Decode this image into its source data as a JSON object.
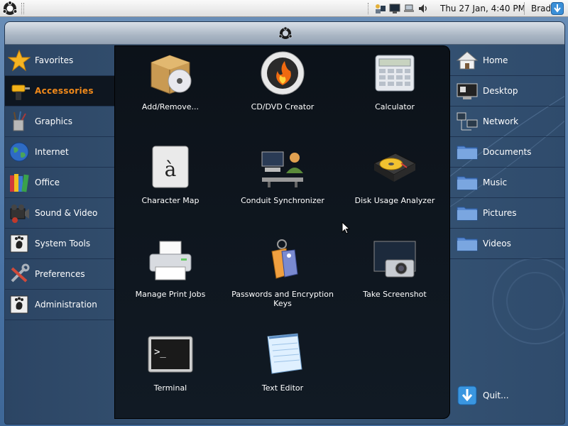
{
  "top_panel": {
    "clock": "Thu 27 Jan,  4:40 PM",
    "user": "Brad"
  },
  "categories": [
    {
      "label": "Favorites",
      "icon": "star-icon"
    },
    {
      "label": "Accessories",
      "icon": "drill-icon",
      "active": true
    },
    {
      "label": "Graphics",
      "icon": "brushes-icon"
    },
    {
      "label": "Internet",
      "icon": "globe-icon"
    },
    {
      "label": "Office",
      "icon": "books-icon"
    },
    {
      "label": "Sound & Video",
      "icon": "film-icon"
    },
    {
      "label": "System Tools",
      "icon": "gnome-foot-icon"
    },
    {
      "label": "Preferences",
      "icon": "wrench-icon"
    },
    {
      "label": "Administration",
      "icon": "gnome-foot-icon"
    }
  ],
  "apps": [
    {
      "label": "Add/Remove...",
      "icon": "package-cd-icon"
    },
    {
      "label": "CD/DVD Creator",
      "icon": "burner-flame-icon"
    },
    {
      "label": "Calculator",
      "icon": "calculator-icon"
    },
    {
      "label": "Character Map",
      "icon": "character-map-icon"
    },
    {
      "label": "Conduit Synchronizer",
      "icon": "sync-computer-icon"
    },
    {
      "label": "Disk Usage Analyzer",
      "icon": "hard-disk-icon"
    },
    {
      "label": "Manage Print Jobs",
      "icon": "printer-icon"
    },
    {
      "label": "Passwords and Encryption Keys",
      "icon": "keys-icon"
    },
    {
      "label": "Take Screenshot",
      "icon": "camera-icon"
    },
    {
      "label": "Terminal",
      "icon": "terminal-icon"
    },
    {
      "label": "Text Editor",
      "icon": "notepad-icon"
    }
  ],
  "places": [
    {
      "label": "Home",
      "icon": "home-icon"
    },
    {
      "label": "Desktop",
      "icon": "desktop-icon"
    },
    {
      "label": "Network",
      "icon": "network-icon"
    },
    {
      "label": "Documents",
      "icon": "folder-icon"
    },
    {
      "label": "Music",
      "icon": "folder-icon"
    },
    {
      "label": "Pictures",
      "icon": "folder-icon"
    },
    {
      "label": "Videos",
      "icon": "folder-icon"
    }
  ],
  "quit": {
    "label": "Quit...",
    "icon": "shutdown-arrow-icon"
  },
  "colors": {
    "accent": "#f28a1a",
    "sidebar": "#2c4564",
    "apps_bg": "#0c1219"
  }
}
